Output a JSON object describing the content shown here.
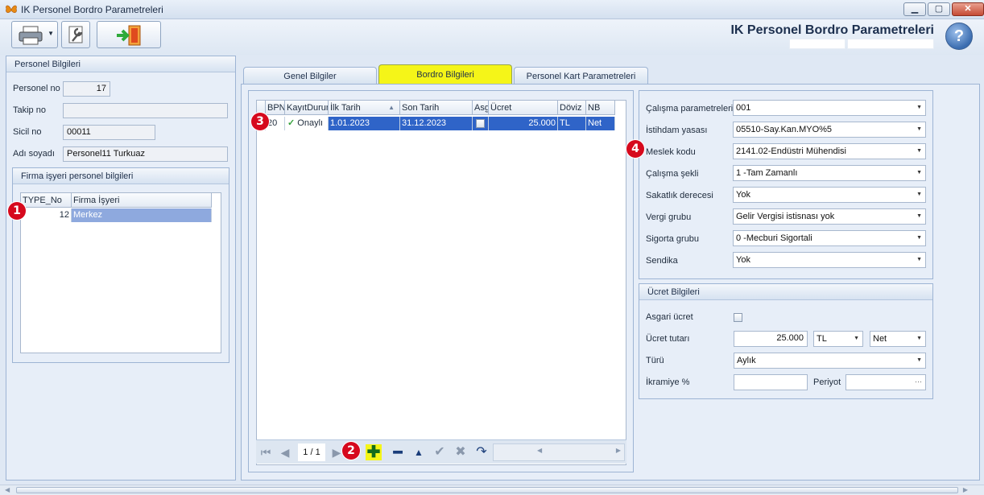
{
  "window": {
    "title": "IK Personel Bordro Parametreleri",
    "minimize": "▁",
    "maximize": "▢",
    "close": "✕"
  },
  "header": {
    "title": "IK Personel Bordro Parametreleri",
    "help": "?"
  },
  "personel": {
    "section": "Personel Bilgileri",
    "personel_no_label": "Personel no",
    "personel_no": "17",
    "takip_no_label": "Takip no",
    "takip_no": "",
    "sicil_no_label": "Sicil no",
    "sicil_no": "00011",
    "adi_soyadi_label": "Adı soyadı",
    "adi_soyadi": "Personel11 Turkuaz"
  },
  "firma": {
    "section": "Firma işyeri personel bilgileri",
    "columns": [
      "TYPE_No",
      "Firma İşyeri"
    ],
    "rows": [
      {
        "type_no": "12",
        "isyeri": "Merkez"
      }
    ]
  },
  "tabs": [
    {
      "label": "Genel Bilgiler"
    },
    {
      "label": "Bordro Bilgileri"
    },
    {
      "label": "Personel Kart Parametreleri"
    }
  ],
  "bordro_grid": {
    "columns": [
      "BPN",
      "KayıtDurumu",
      "İlk Tarih",
      "Son Tarih",
      "Asgari",
      "Ücret",
      "Döviz",
      "NB"
    ],
    "rows": [
      {
        "bpn": "20",
        "durum": "Onaylı",
        "ilk": "1.01.2023",
        "son": "31.12.2023",
        "asgari": "",
        "ucret": "25.000",
        "doviz": "TL",
        "nb": "Net"
      }
    ],
    "pager": "1 / 1"
  },
  "params": {
    "calisma_param_label": "Çalışma parametreleri",
    "calisma_param": "001",
    "istihdam_label": "İstihdam yasası",
    "istihdam": "05510-Say.Kan.MYO%5",
    "meslek_label": "Meslek kodu",
    "meslek": "2141.02-Endüstri Mühendisi",
    "calisma_sekli_label": "Çalışma şekli",
    "calisma_sekli": "1 -Tam Zamanlı",
    "sakatlik_label": "Sakatlık derecesi",
    "sakatlik": "Yok",
    "vergi_label": "Vergi grubu",
    "vergi": "Gelir Vergisi istisnası yok",
    "sigorta_label": "Sigorta grubu",
    "sigorta": "0 -Mecburi Sigortali",
    "sendika_label": "Sendika",
    "sendika": "Yok"
  },
  "ucret": {
    "section": "Ücret Bilgileri",
    "asgari_label": "Asgari ücret",
    "asgari_checked": false,
    "tutar_label": "Ücret tutarı",
    "tutar": "25.000",
    "doviz": "TL",
    "net": "Net",
    "turu_label": "Türü",
    "turu": "Aylık",
    "ikramiye_label": "İkramiye %",
    "ikramiye": "",
    "periyot_label": "Periyot",
    "periyot": "",
    "ellipsis": "···"
  },
  "markers": [
    "1",
    "2",
    "3",
    "4"
  ],
  "colors": {
    "active_tab": "#f5f518",
    "selected_row": "#2f64c8",
    "marker": "#d6091d"
  }
}
